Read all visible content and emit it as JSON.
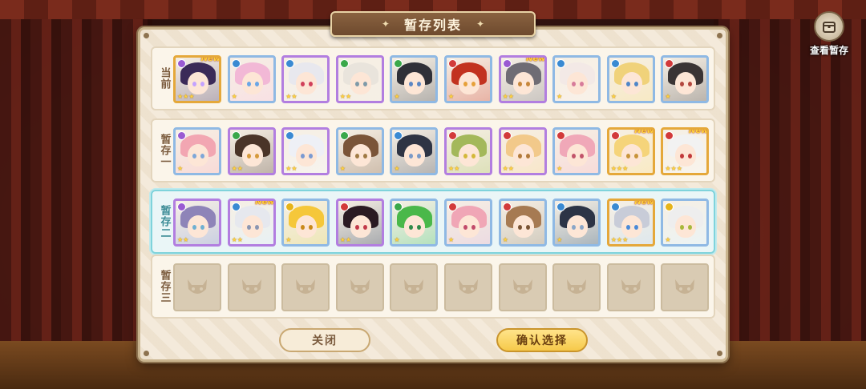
{
  "header": {
    "title": "暂存列表"
  },
  "view_stash": {
    "label": "查看暂存"
  },
  "rows": [
    {
      "label": "当前",
      "active": false,
      "cards": [
        {
          "rarity": 3,
          "element": "purple",
          "hair": "#3b2a58",
          "eyes": "#c4a2ff",
          "new": "New"
        },
        {
          "rarity": 1,
          "element": "blue",
          "hair": "#f2b8d6",
          "eyes": "#6aa6e6",
          "new": ""
        },
        {
          "rarity": 2,
          "element": "blue",
          "hair": "#e8e8ee",
          "eyes": "#d1405a",
          "new": ""
        },
        {
          "rarity": 2,
          "element": "green",
          "hair": "#e9e4dc",
          "eyes": "#7f9aa8",
          "new": ""
        },
        {
          "rarity": 1,
          "element": "green",
          "hair": "#2f3038",
          "eyes": "#5b86c4",
          "new": ""
        },
        {
          "rarity": 1,
          "element": "red",
          "hair": "#c2321f",
          "eyes": "#e6a13a",
          "new": ""
        },
        {
          "rarity": 2,
          "element": "purple",
          "hair": "#6f6c74",
          "eyes": "#c7863a",
          "new": "New"
        },
        {
          "rarity": 1,
          "element": "blue",
          "hair": "#f3e9e6",
          "eyes": "#d77b9a",
          "new": ""
        },
        {
          "rarity": 1,
          "element": "blue",
          "hair": "#f0d27a",
          "eyes": "#4f86c8",
          "new": ""
        },
        {
          "rarity": 1,
          "element": "red",
          "hair": "#3a3434",
          "eyes": "#b3473e",
          "new": ""
        }
      ]
    },
    {
      "label": "暂存一",
      "active": false,
      "cards": [
        {
          "rarity": 1,
          "element": "purple",
          "hair": "#f2a6b2",
          "eyes": "#7ea7d8",
          "new": ""
        },
        {
          "rarity": 2,
          "element": "green",
          "hair": "#4a3428",
          "eyes": "#d69a3c",
          "new": ""
        },
        {
          "rarity": 2,
          "element": "blue",
          "hair": "#eef0f6",
          "eyes": "#7a9ad2",
          "new": ""
        },
        {
          "rarity": 1,
          "element": "green",
          "hair": "#7a5438",
          "eyes": "#a07a44",
          "new": ""
        },
        {
          "rarity": 1,
          "element": "blue",
          "hair": "#2e3444",
          "eyes": "#7a9ac8",
          "new": ""
        },
        {
          "rarity": 2,
          "element": "red",
          "hair": "#a3b85a",
          "eyes": "#d4b83a",
          "new": ""
        },
        {
          "rarity": 2,
          "element": "red",
          "hair": "#f2c98a",
          "eyes": "#b37a3a",
          "new": ""
        },
        {
          "rarity": 1,
          "element": "red",
          "hair": "#f0a8b8",
          "eyes": "#c2546a",
          "new": ""
        },
        {
          "rarity": 3,
          "element": "red",
          "hair": "#f5d47a",
          "eyes": "#c8943a",
          "new": "New"
        },
        {
          "rarity": 3,
          "element": "red",
          "hair": "#f2f2f2",
          "eyes": "#c2393a",
          "new": "New"
        }
      ]
    },
    {
      "label": "暂存二",
      "active": true,
      "cards": [
        {
          "rarity": 2,
          "element": "purple",
          "hair": "#8e84b8",
          "eyes": "#6fb0d2",
          "new": ""
        },
        {
          "rarity": 2,
          "element": "blue",
          "hair": "#e6e8ee",
          "eyes": "#8a96b2",
          "new": "New"
        },
        {
          "rarity": 1,
          "element": "yellow",
          "hair": "#f5c73a",
          "eyes": "#c98a1a",
          "new": ""
        },
        {
          "rarity": 2,
          "element": "red",
          "hair": "#2a1a22",
          "eyes": "#c23a4a",
          "new": ""
        },
        {
          "rarity": 1,
          "element": "green",
          "hair": "#4ab84a",
          "eyes": "#2f8a4a",
          "new": ""
        },
        {
          "rarity": 1,
          "element": "red",
          "hair": "#f0a6b6",
          "eyes": "#c24a6a",
          "new": ""
        },
        {
          "rarity": 1,
          "element": "red",
          "hair": "#a67a52",
          "eyes": "#7a5434",
          "new": ""
        },
        {
          "rarity": 1,
          "element": "blue",
          "hair": "#2c3446",
          "eyes": "#8aa6c8",
          "new": ""
        },
        {
          "rarity": 3,
          "element": "blue",
          "hair": "#c8ccd8",
          "eyes": "#4a8ad8",
          "new": "New"
        },
        {
          "rarity": 1,
          "element": "yellow",
          "hair": "#eeeeee",
          "eyes": "#a8b83a",
          "new": ""
        }
      ]
    },
    {
      "label": "暂存三",
      "active": false,
      "cards": []
    }
  ],
  "empty_slots": 10,
  "buttons": {
    "close": "关闭",
    "confirm": "确认选择"
  },
  "colors": {
    "element_purple": "#9a5ad2",
    "element_blue": "#3a8ad2",
    "element_green": "#3aa84a",
    "element_red": "#d23a3a",
    "element_yellow": "#e6b41a"
  }
}
